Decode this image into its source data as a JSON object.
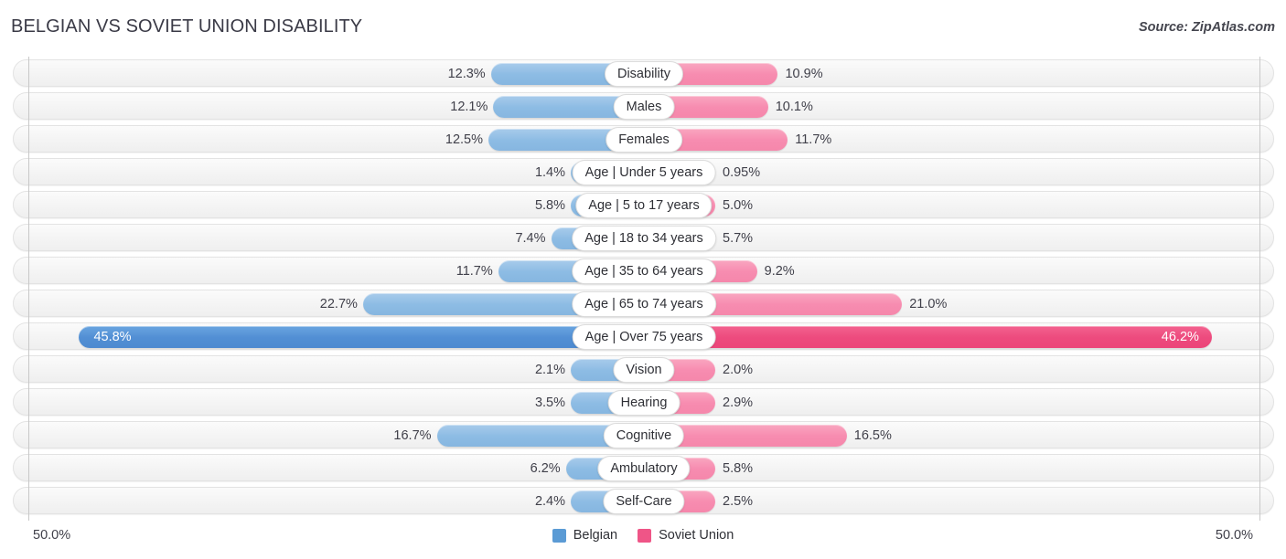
{
  "header": {
    "title": "BELGIAN VS SOVIET UNION DISABILITY",
    "source": "Source: ZipAtlas.com"
  },
  "axis": {
    "left_tick": "50.0%",
    "right_tick": "50.0%",
    "max": 50.0
  },
  "legend": {
    "items": [
      {
        "label": "Belgian",
        "color": "#5b9bd5"
      },
      {
        "label": "Soviet Union",
        "color": "#ef5587"
      }
    ]
  },
  "colors": {
    "belgian": "#8dbce4",
    "belgian_highlight": "#528fd4",
    "soviet": "#f78cb0",
    "soviet_highlight": "#ed4b7e",
    "track": "#f4f4f4",
    "text": "#40404a"
  },
  "chart_data": {
    "type": "bar",
    "title": "BELGIAN VS SOVIET UNION DISABILITY",
    "subtitle": "Source: ZipAtlas.com",
    "orientation": "horizontal-diverging",
    "xlabel": "",
    "ylabel": "",
    "xlim": [
      -50.0,
      50.0
    ],
    "axis_tick_labels": [
      "50.0%",
      "50.0%"
    ],
    "grid": false,
    "legend_position": "bottom-center",
    "categories": [
      "Disability",
      "Males",
      "Females",
      "Age | Under 5 years",
      "Age | 5 to 17 years",
      "Age | 18 to 34 years",
      "Age | 35 to 64 years",
      "Age | 65 to 74 years",
      "Age | Over 75 years",
      "Vision",
      "Hearing",
      "Cognitive",
      "Ambulatory",
      "Self-Care"
    ],
    "series": [
      {
        "name": "Belgian",
        "color": "#8dbce4",
        "values": [
          12.3,
          12.1,
          12.5,
          1.4,
          5.8,
          7.4,
          11.7,
          22.7,
          45.8,
          2.1,
          3.5,
          16.7,
          6.2,
          2.4
        ],
        "labels": [
          "12.3%",
          "12.1%",
          "12.5%",
          "1.4%",
          "5.8%",
          "7.4%",
          "11.7%",
          "22.7%",
          "45.8%",
          "2.1%",
          "3.5%",
          "16.7%",
          "6.2%",
          "2.4%"
        ]
      },
      {
        "name": "Soviet Union",
        "color": "#f78cb0",
        "values": [
          10.9,
          10.1,
          11.7,
          0.95,
          5.0,
          5.7,
          9.2,
          21.0,
          46.2,
          2.0,
          2.9,
          16.5,
          5.8,
          2.5
        ],
        "labels": [
          "10.9%",
          "10.1%",
          "11.7%",
          "0.95%",
          "5.0%",
          "5.7%",
          "9.2%",
          "21.0%",
          "46.2%",
          "2.0%",
          "2.9%",
          "16.5%",
          "5.8%",
          "2.5%"
        ]
      }
    ],
    "highlighted_row": "Age | Over 75 years"
  }
}
